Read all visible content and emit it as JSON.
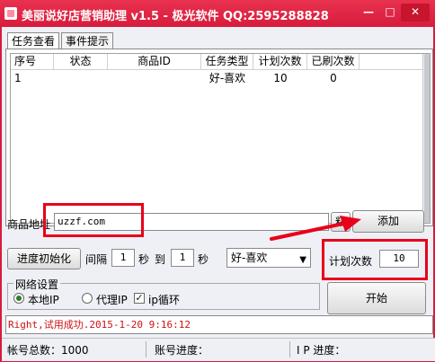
{
  "window": {
    "title": "美丽说好店营销助理 v1.5 - 极光软件 QQ:2595288828",
    "minimize": "—",
    "maximize": "□",
    "close": "✕"
  },
  "tabs": [
    {
      "label": "任务查看",
      "active": true
    },
    {
      "label": "事件提示",
      "active": false
    }
  ],
  "grid": {
    "columns": [
      "序号",
      "状态",
      "商品ID",
      "任务类型",
      "计划次数",
      "已刷次数"
    ],
    "rows": [
      [
        "1",
        "",
        "",
        "好-喜欢",
        "10",
        "0"
      ]
    ]
  },
  "form": {
    "product_url_label": "商品地址",
    "product_url_value": "uzzf.com",
    "paste_label": "粘",
    "add_label": "添加",
    "init_label": "进度初始化",
    "interval_label": "间隔",
    "interval_from": "1",
    "sec_label_1": "秒",
    "to_label": "到",
    "interval_to": "1",
    "sec_label_2": "秒",
    "task_type_selected": "好-喜欢",
    "plan_count_label": "计划次数",
    "plan_count_value": "10",
    "start_label": "开始"
  },
  "network": {
    "title": "网络设置",
    "local_ip_label": "本地IP",
    "proxy_ip_label": "代理IP",
    "ip_loop_label": "ip循环",
    "local_ip_selected": true,
    "ip_loop_checked": true
  },
  "log_text": "Right,试用成功.2015-1-20 9:16:12",
  "status": {
    "account_total": "帐号总数：1000",
    "account_progress": "账号进度：",
    "ip_progress": "I P 进度："
  },
  "colors": {
    "titlebar": "#d81b3c",
    "annotation_red": "#e8001a",
    "log_text": "#d01010"
  }
}
